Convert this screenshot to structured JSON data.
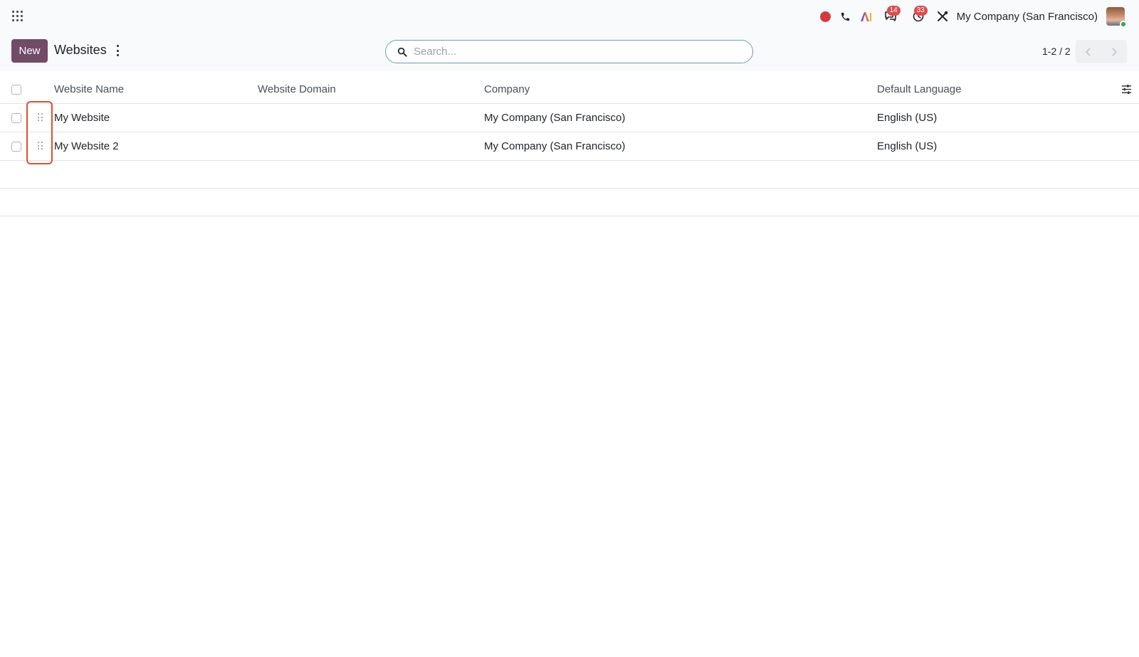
{
  "navbar": {
    "company_name": "My Company (San Francisco)",
    "messages_count": "14",
    "activities_count": "33",
    "icons": [
      "apps-icon",
      "record-icon",
      "phone-icon",
      "ai-icon",
      "chat-icon",
      "clock-icon",
      "tools-icon",
      "avatar"
    ]
  },
  "control_panel": {
    "new_label": "New",
    "title": "Websites",
    "search_placeholder": "Search...",
    "pager": "1-2 / 2"
  },
  "list": {
    "columns": [
      "Website Name",
      "Website Domain",
      "Company",
      "Default Language"
    ],
    "rows": [
      {
        "name": "My Website",
        "domain": "",
        "company": "My Company (San Francisco)",
        "language": "English (US)"
      },
      {
        "name": "My Website 2",
        "domain": "",
        "company": "My Company (San Francisco)",
        "language": "English (US)"
      }
    ]
  },
  "colors": {
    "primary": "#714b67",
    "badge": "#e04b4b",
    "highlight": "#d9532f",
    "record": "#d9363e"
  }
}
